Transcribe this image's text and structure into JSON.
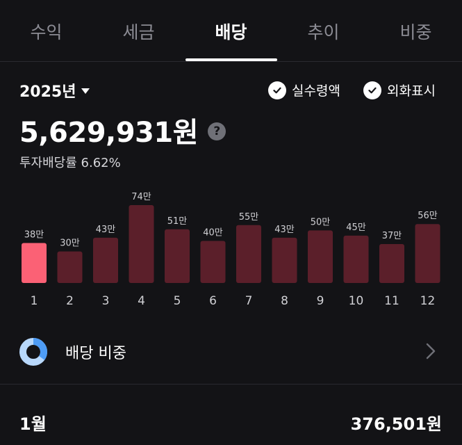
{
  "tabs": [
    {
      "label": "수익"
    },
    {
      "label": "세금"
    },
    {
      "label": "배당"
    },
    {
      "label": "추이"
    },
    {
      "label": "비중"
    }
  ],
  "active_tab": "배당",
  "summary": {
    "year": "2025년",
    "options": [
      {
        "label": "실수령액",
        "checked": true
      },
      {
        "label": "외화표시",
        "checked": true
      }
    ],
    "total": "5,629,931원",
    "help_icon": "?",
    "rate": "투자배당률 6.62%"
  },
  "chart_data": {
    "type": "bar",
    "categories": [
      "1",
      "2",
      "3",
      "4",
      "5",
      "6",
      "7",
      "8",
      "9",
      "10",
      "11",
      "12"
    ],
    "values": [
      38,
      30,
      43,
      74,
      51,
      40,
      55,
      43,
      50,
      45,
      37,
      56
    ],
    "data_labels": [
      "38만",
      "30만",
      "43만",
      "74만",
      "51만",
      "40만",
      "55만",
      "43만",
      "50만",
      "45만",
      "37만",
      "56만"
    ],
    "highlight_index": 0,
    "ylim": [
      0,
      74
    ],
    "colors": {
      "highlight": "#fb6175",
      "normal": "#5b1f2a"
    }
  },
  "ratio_row": {
    "label": "배당 비중"
  },
  "month_summary": {
    "month": "1월",
    "amount": "376,501원"
  },
  "colors": {
    "background": "#131316",
    "accent_blue": "#4e9cf5",
    "light_blue": "#b8d8fb"
  }
}
